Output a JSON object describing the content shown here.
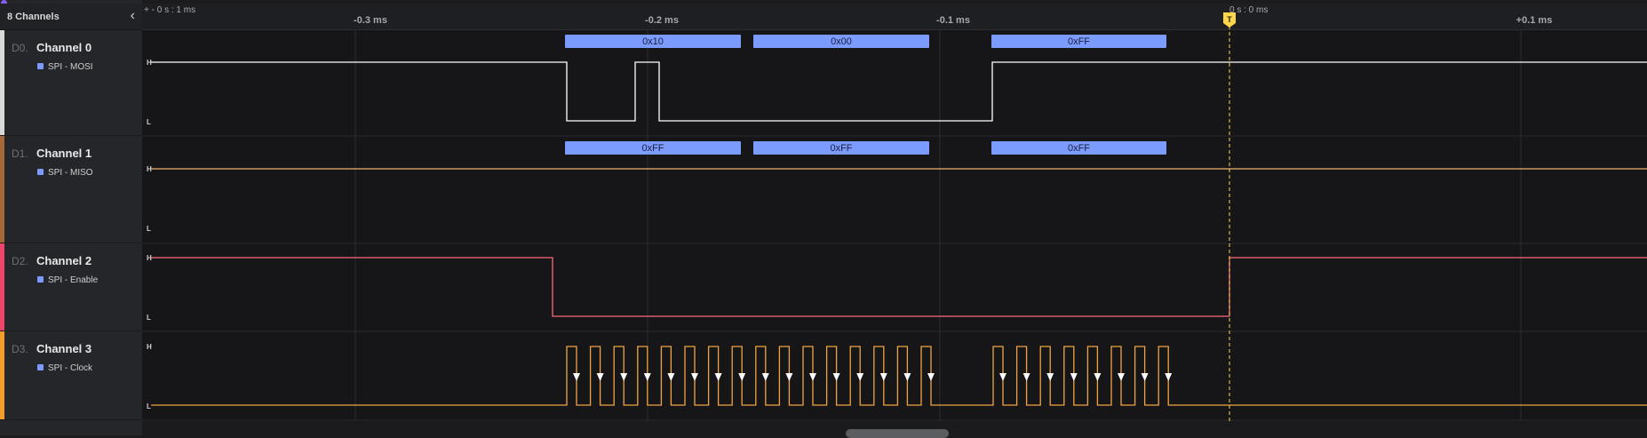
{
  "sidebar": {
    "title": "8 Channels",
    "collapse_icon": "chevron-left-icon"
  },
  "ruler": {
    "left_label": "+ - 0 s : 1 ms",
    "trigger_label": "0 s : 0 ms",
    "ticks": [
      "-0.3 ms",
      "-0.2 ms",
      "-0.1 ms",
      "+0.1 ms"
    ]
  },
  "trigger": {
    "marker": "T",
    "color": "#ffd54a"
  },
  "channels": [
    {
      "dnum": "D0.",
      "name": "Channel 0",
      "analyzer": "SPI - MOSI",
      "color": "#ffffff",
      "bar_color": "#d9d9d9",
      "high": "H",
      "low": "L",
      "frames": [
        "0x10",
        "0x00",
        "0xFF"
      ]
    },
    {
      "dnum": "D1.",
      "name": "Channel 1",
      "analyzer": "SPI - MISO",
      "color": "#f0b470",
      "bar_color": "#a5683b",
      "high": "H",
      "low": "L",
      "frames": [
        "0xFF",
        "0xFF",
        "0xFF"
      ]
    },
    {
      "dnum": "D2.",
      "name": "Channel 2",
      "analyzer": "SPI - Enable",
      "color": "#ff6a7a",
      "bar_color": "#f0446a",
      "high": "H",
      "low": "L",
      "frames": []
    },
    {
      "dnum": "D3.",
      "name": "Channel 3",
      "analyzer": "SPI - Clock",
      "color": "#f0a340",
      "bar_color": "#f39c2c",
      "high": "H",
      "low": "L",
      "frames": []
    }
  ],
  "colors": {
    "frame_bg": "#7c9bff",
    "frame_text": "#1a1f3a",
    "grid": "#2b2c30",
    "analyzer_square": "#7c9bff"
  }
}
